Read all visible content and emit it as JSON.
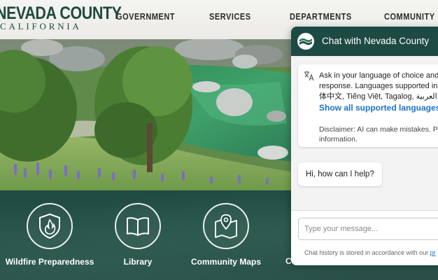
{
  "header": {
    "logo_main": "NEVADA COUNTY",
    "logo_sub": "CALIFORNIA",
    "nav": [
      "GOVERNMENT",
      "SERVICES",
      "DEPARTMENTS",
      "COMMUNITY"
    ]
  },
  "quick_links": [
    {
      "label": "Wildfire Preparedness",
      "icon": "shield-flame-icon"
    },
    {
      "label": "Library",
      "icon": "open-book-icon"
    },
    {
      "label": "Community Maps",
      "icon": "map-pin-icon"
    },
    {
      "label": "C",
      "icon": "partial-icon"
    }
  ],
  "chat": {
    "title": "Chat with Nevada County",
    "intro_line1": "Ask in your language of choice and w",
    "intro_line2": "response. Languages supported inclu",
    "intro_line3": "体中文, Tiếng Việt, Tagalog, العربية,",
    "languages_link": "Show all supported languages",
    "disclaimer_line1": "Disclaimer: AI can make mistakes. Ple",
    "disclaimer_line2": "information.",
    "greeting": "Hi, how can I help?",
    "input_placeholder": "Type your message...",
    "history_note": "Chat history is stored in accordance with our ",
    "history_link": "pr",
    "header_color": "#1d4a42",
    "link_color": "#1a73c9"
  },
  "colors": {
    "brand_teal": "#1e4a40",
    "band": "#27524a"
  }
}
